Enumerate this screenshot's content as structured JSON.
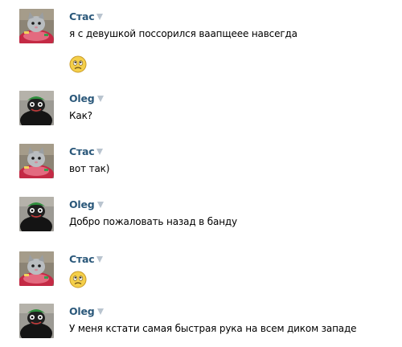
{
  "messages": [
    {
      "author": "Стас",
      "text": "я с девушкой поссорился ваапщеее навсегда",
      "emoji": "worried-face",
      "avatar": "cat-avatar"
    },
    {
      "author": "Oleg",
      "text": "Как?",
      "avatar": "creature-avatar"
    },
    {
      "author": "Стас",
      "text": "вот так)",
      "avatar": "cat-avatar"
    },
    {
      "author": "Oleg",
      "text": "Добро пожаловать назад в банду",
      "avatar": "creature-avatar"
    },
    {
      "author": "Стас",
      "emoji": "worried-face",
      "avatar": "cat-avatar"
    },
    {
      "author": "Oleg",
      "text": "У меня кстати самая быстрая рука на всем диком западе",
      "avatar": "creature-avatar"
    }
  ],
  "colors": {
    "author_link": "#2b587a",
    "caret": "#b9c4cf",
    "text": "#000000",
    "background": "#ffffff"
  }
}
